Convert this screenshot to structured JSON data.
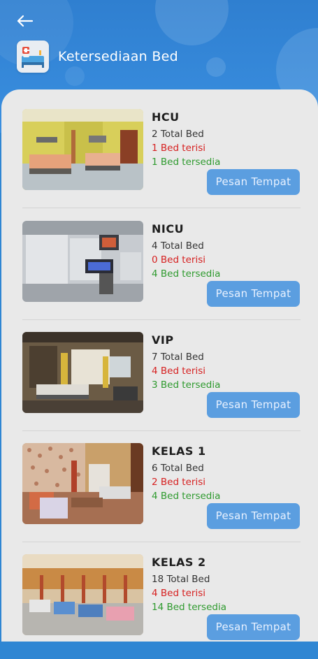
{
  "header": {
    "title": "Ketersediaan Bed",
    "back_icon": "arrow-left-icon",
    "app_icon": "hospital-bed-icon"
  },
  "colors": {
    "header_bg": "#2f86d3",
    "sheet_bg": "#e9e9e9",
    "button_bg": "#5b9ee0",
    "occupied": "#d62020",
    "available": "#2e9a2e"
  },
  "rooms": [
    {
      "name": "HCU",
      "total": "2 Total Bed",
      "occupied": "1 Bed terisi",
      "available": "1 Bed tersedia",
      "button": "Pesan Tempat"
    },
    {
      "name": "NICU",
      "total": "4 Total Bed",
      "occupied": "0 Bed terisi",
      "available": "4 Bed tersedia",
      "button": "Pesan Tempat"
    },
    {
      "name": "VIP",
      "total": "7 Total Bed",
      "occupied": "4 Bed terisi",
      "available": "3 Bed tersedia",
      "button": "Pesan Tempat"
    },
    {
      "name": "KELAS 1",
      "total": "6 Total Bed",
      "occupied": "2 Bed terisi",
      "available": "4 Bed tersedia",
      "button": "Pesan Tempat"
    },
    {
      "name": "KELAS 2",
      "total": "18 Total Bed",
      "occupied": "4 Bed terisi",
      "available": "14 Bed tersedia",
      "button": "Pesan Tempat"
    }
  ]
}
